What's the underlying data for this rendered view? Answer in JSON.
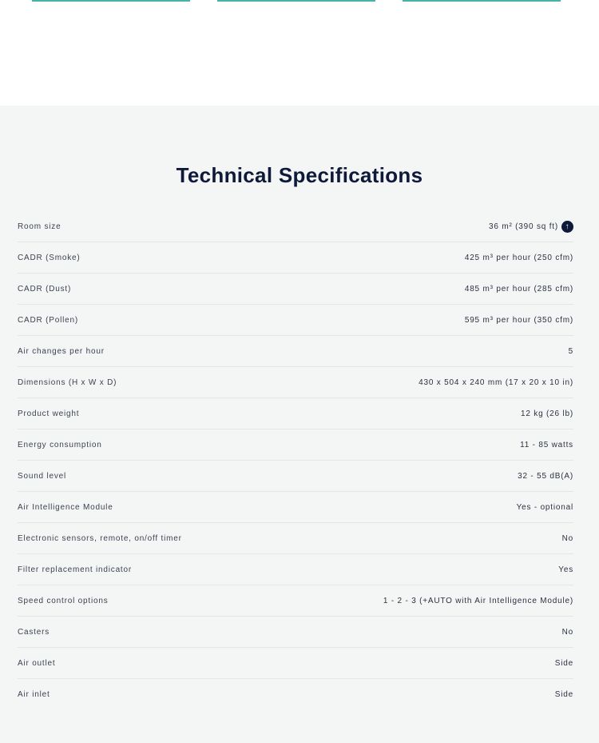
{
  "specs": {
    "title": "Technical Specifications",
    "rows": [
      {
        "label": "Room size",
        "value": "36 m² (390 sq ft)"
      },
      {
        "label": "CADR (Smoke)",
        "value": "425 m³ per hour (250 cfm)"
      },
      {
        "label": "CADR (Dust)",
        "value": "485 m³ per hour (285 cfm)"
      },
      {
        "label": "CADR (Pollen)",
        "value": "595 m³ per hour (350 cfm)"
      },
      {
        "label": "Air changes per hour",
        "value": "5"
      },
      {
        "label": "Dimensions (H x W x D)",
        "value": "430 x 504 x 240 mm (17 x 20 x 10 in)"
      },
      {
        "label": "Product weight",
        "value": "12 kg (26 lb)"
      },
      {
        "label": "Energy consumption",
        "value": "11 - 85 watts"
      },
      {
        "label": "Sound level",
        "value": "32 - 55 dB(A)"
      },
      {
        "label": "Air Intelligence Module",
        "value": "Yes - optional"
      },
      {
        "label": "Electronic sensors, remote, on/off timer",
        "value": "No"
      },
      {
        "label": "Filter replacement indicator",
        "value": "Yes"
      },
      {
        "label": "Speed control options",
        "value": "1 - 2 - 3 (+AUTO with Air Intelligence Module)"
      },
      {
        "label": "Casters",
        "value": "No"
      },
      {
        "label": "Air outlet",
        "value": "Side"
      },
      {
        "label": "Air inlet",
        "value": "Side"
      }
    ],
    "info_icon": "up-arrow-circle-icon"
  },
  "colors": {
    "accent": "#46b3a6",
    "heading": "#0f1a3a",
    "section_bg": "#f4f5f5"
  }
}
